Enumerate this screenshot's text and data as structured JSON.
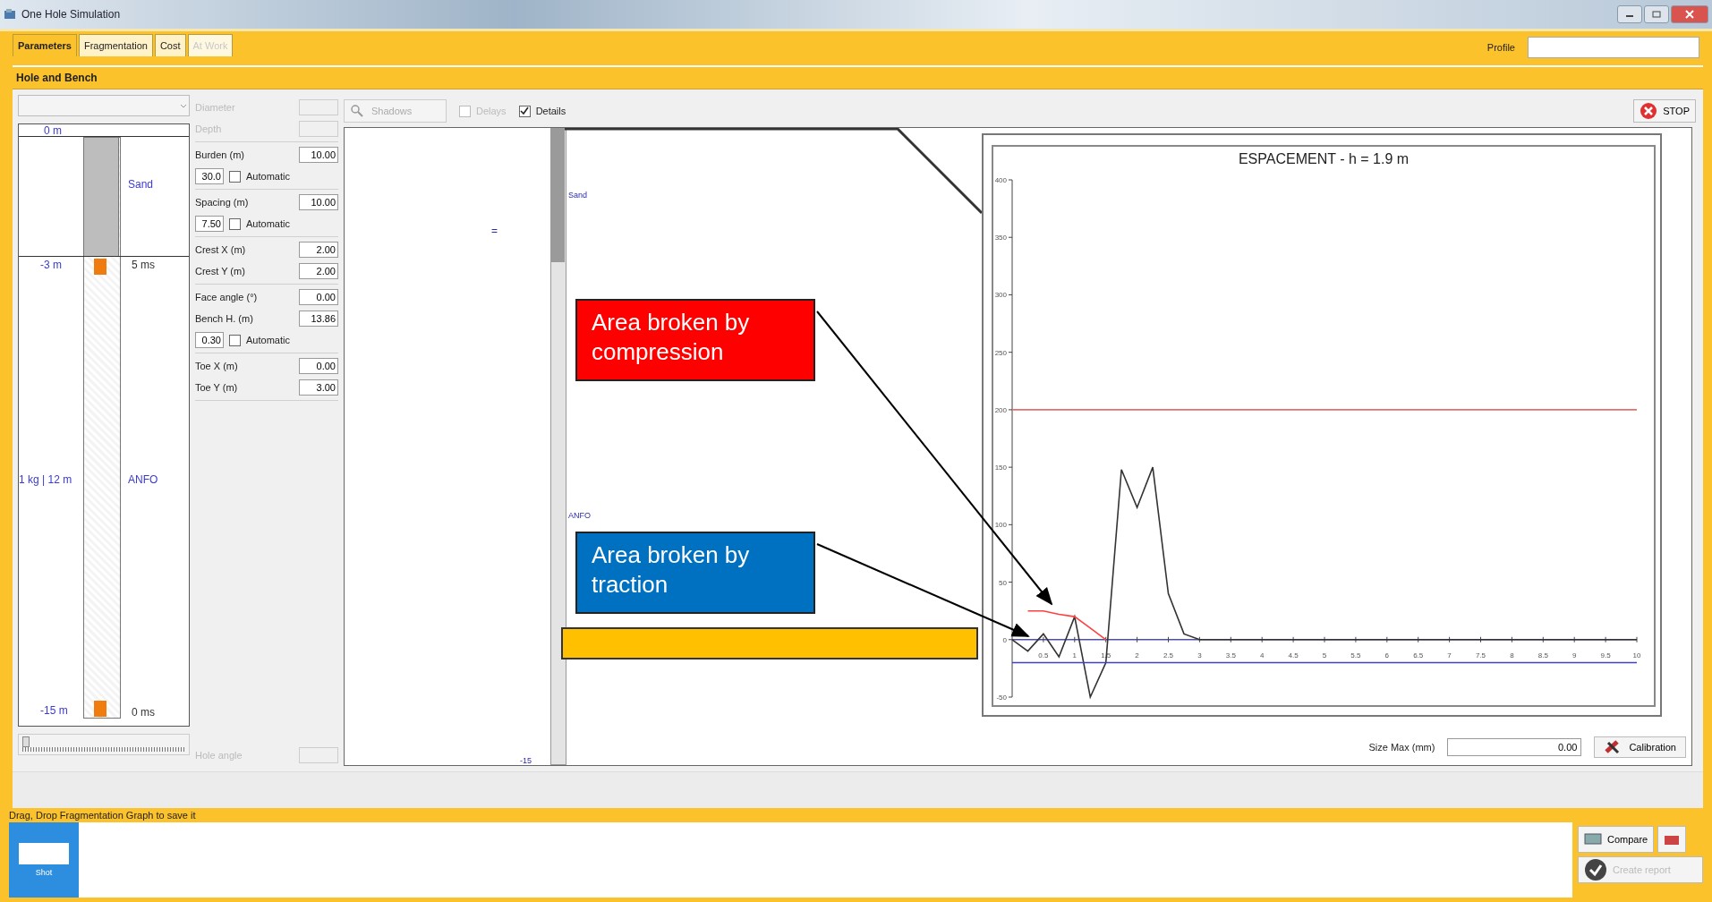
{
  "window": {
    "title": "One Hole Simulation"
  },
  "tabs": [
    {
      "label": "Parameters",
      "selected": true,
      "disabled": false
    },
    {
      "label": "Fragmentation",
      "selected": false,
      "disabled": false
    },
    {
      "label": "Cost",
      "selected": false,
      "disabled": false
    },
    {
      "label": "At Work",
      "selected": false,
      "disabled": true
    }
  ],
  "profile": {
    "label": "Profile"
  },
  "section": {
    "title": "Hole and Bench"
  },
  "depth_slider": {
    "level": 0.02
  },
  "hole_column": {
    "top_depth": "0 m",
    "stemming": "Sand",
    "stemming_depth": "-3 m",
    "top_delay": "5 ms",
    "charge": "1 kg | 12 m",
    "explosive": "ANFO",
    "bottom_depth": "-15 m",
    "bottom_delay": "0 ms"
  },
  "parameters": [
    [
      {
        "kind": "field",
        "label": "Diameter",
        "disabled": true
      },
      {
        "kind": "field",
        "label": "Depth",
        "disabled": true
      }
    ],
    [
      {
        "kind": "field",
        "label": "Burden (m)",
        "value": "10.00",
        "disabled": false
      },
      {
        "kind": "auto",
        "value": "30.0",
        "label": "Automatic",
        "checked": false
      }
    ],
    [
      {
        "kind": "field",
        "label": "Spacing (m)",
        "value": "10.00",
        "disabled": false
      },
      {
        "kind": "auto",
        "value": "7.50",
        "label": "Automatic",
        "checked": false
      }
    ],
    [
      {
        "kind": "field",
        "label": "Crest X (m)",
        "value": "2.00",
        "disabled": false
      },
      {
        "kind": "field",
        "label": "Crest Y (m)",
        "value": "2.00",
        "disabled": false
      }
    ],
    [
      {
        "kind": "field",
        "label": "Face angle (°)",
        "value": "0.00",
        "disabled": false
      },
      {
        "kind": "field",
        "label": "Bench H. (m)",
        "value": "13.86",
        "disabled": false
      },
      {
        "kind": "auto",
        "value": "0.30",
        "label": "Automatic",
        "checked": false
      }
    ],
    [
      {
        "kind": "field",
        "label": "Toe X (m)",
        "value": "0.00",
        "disabled": false
      },
      {
        "kind": "field",
        "label": "Toe Y (m)",
        "value": "3.00",
        "disabled": false
      }
    ]
  ],
  "hole_angle": {
    "label": "Hole angle",
    "disabled": true
  },
  "toolbar": {
    "shadows": {
      "label": "Shadows",
      "disabled": true
    },
    "delays": {
      "label": "Delays",
      "checked": false,
      "disabled": true
    },
    "details": {
      "label": "Details",
      "checked": true,
      "disabled": false
    },
    "stop": {
      "label": "STOP"
    }
  },
  "section_view": {
    "marker": "=",
    "stemming": "Sand",
    "explosive": "ANFO",
    "depth": "-15"
  },
  "annotations": [
    {
      "text": "Area broken by compression",
      "color": "#ff0000"
    },
    {
      "text": "Area broken by traction",
      "color": "#0070c0"
    }
  ],
  "chart_data": {
    "type": "line",
    "title": "ESPACEMENT - h = 1.9 m",
    "x": [
      0,
      0.25,
      0.5,
      0.75,
      1,
      1.25,
      1.5,
      1.75,
      2,
      2.25,
      2.5,
      2.75,
      3,
      3.25,
      3.5,
      3.75,
      4,
      4.25,
      4.5,
      4.75,
      5,
      5.25,
      5.5,
      5.75,
      6,
      6.25,
      6.5,
      6.75,
      7,
      7.25,
      7.5,
      7.75,
      8,
      8.25,
      8.5,
      8.75,
      9,
      9.25,
      9.5,
      9.75,
      10
    ],
    "series": [
      {
        "color": "#333333",
        "values": [
          0,
          -10,
          5,
          -15,
          20,
          -50,
          -20,
          148,
          115,
          150,
          40,
          5,
          0,
          0,
          0,
          0,
          0,
          0,
          0,
          0,
          0,
          0,
          0,
          0,
          0,
          0,
          0,
          0,
          0,
          0,
          0,
          0,
          0,
          0,
          0,
          0,
          0,
          0,
          0,
          0,
          0
        ]
      },
      {
        "color": "#e07070",
        "values": [
          200,
          200,
          200,
          200,
          200,
          200,
          200,
          200,
          200,
          200,
          200,
          200,
          200,
          200,
          200,
          200,
          200,
          200,
          200,
          200,
          200,
          200,
          200,
          200,
          200,
          200,
          200,
          200,
          200,
          200,
          200,
          200,
          200,
          200,
          200,
          200,
          200,
          200,
          200,
          200,
          200
        ]
      },
      {
        "color": "#ff4040",
        "values": [
          null,
          25,
          25,
          22,
          20,
          10,
          0,
          null,
          null,
          null,
          null,
          null,
          null,
          null,
          null,
          null,
          null,
          null,
          null,
          null,
          null,
          null,
          null,
          null,
          null,
          null,
          null,
          null,
          null,
          null,
          null,
          null,
          null,
          null,
          null,
          null,
          null,
          null,
          null,
          null,
          null
        ]
      },
      {
        "color": "#4040c0",
        "values": [
          -20,
          -20,
          -20,
          -20,
          -20,
          -20,
          -20,
          -20,
          -20,
          -20,
          -20,
          -20,
          -20,
          -20,
          -20,
          -20,
          -20,
          -20,
          -20,
          -20,
          -20,
          -20,
          -20,
          -20,
          -20,
          -20,
          -20,
          -20,
          -20,
          -20,
          -20,
          -20,
          -20,
          -20,
          -20,
          -20,
          -20,
          -20,
          -20,
          -20,
          -20
        ]
      }
    ],
    "xlim": [
      0,
      10
    ],
    "ylim": [
      -50,
      400
    ],
    "xticks": [
      0.5,
      1,
      1.5,
      2,
      2.5,
      3,
      3.5,
      4,
      4.5,
      5,
      5.5,
      6,
      6.5,
      7,
      7.5,
      8,
      8.5,
      9,
      9.5,
      10
    ],
    "yticks": [
      -50,
      0,
      50,
      100,
      150,
      200,
      250,
      300,
      350,
      400
    ]
  },
  "size_max": {
    "label": "Size Max (mm)",
    "value": "0.00"
  },
  "calibration": {
    "label": "Calibration"
  },
  "status": {
    "text": "Drag, Drop Fragmentation Graph to save it"
  },
  "shots": [
    {
      "label": "Shot",
      "selected": true
    }
  ],
  "actions": {
    "compare": {
      "label": "Compare"
    },
    "report": {
      "label": "Create report",
      "disabled": true
    }
  }
}
